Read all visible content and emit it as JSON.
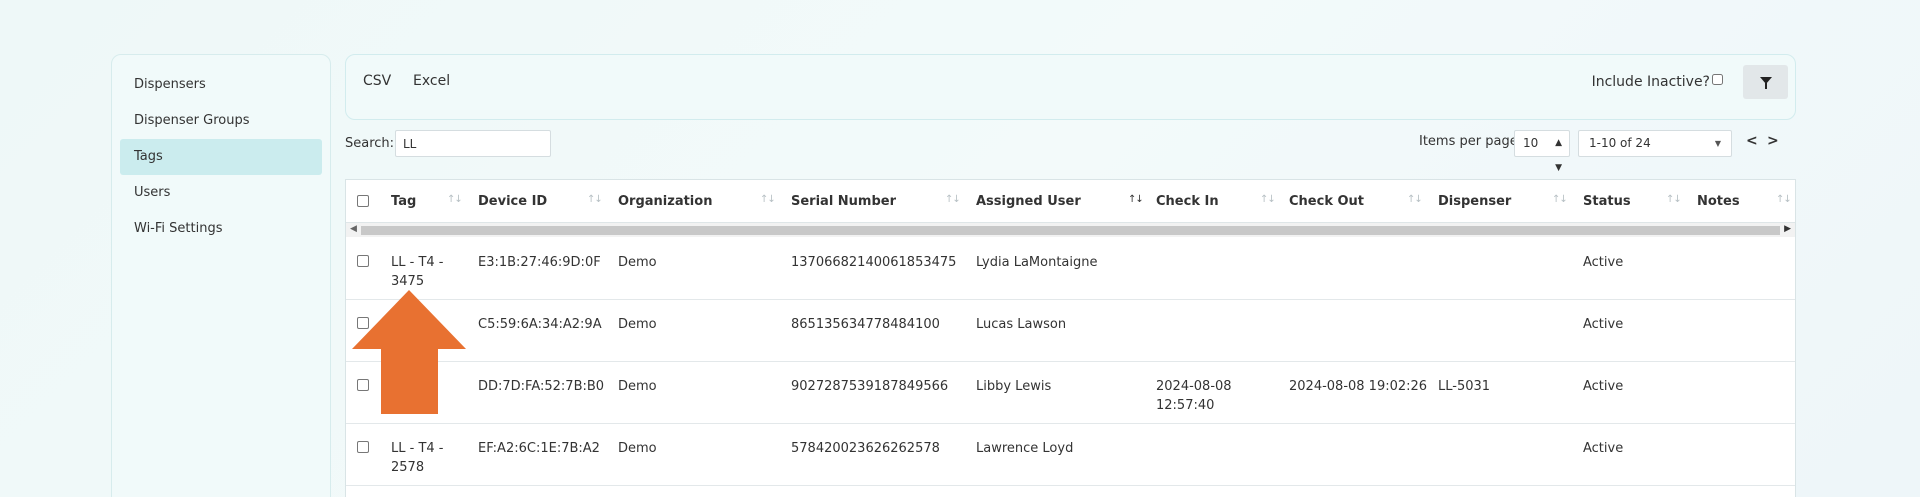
{
  "sidebar": {
    "items": [
      {
        "label": "Dispensers",
        "active": false
      },
      {
        "label": "Dispenser Groups",
        "active": false
      },
      {
        "label": "Tags",
        "active": true
      },
      {
        "label": "Users",
        "active": false
      },
      {
        "label": "Wi-Fi Settings",
        "active": false
      }
    ]
  },
  "toolbar": {
    "csv_label": "CSV",
    "excel_label": "Excel",
    "include_inactive_label": "Include Inactive?",
    "include_inactive_checked": false,
    "filter_icon": "filter-icon"
  },
  "search": {
    "label": "Search:",
    "value": "LL"
  },
  "pagination": {
    "items_per_page_label": "Items per page:",
    "items_per_page_value": "10",
    "range_value": "1-10 of 24",
    "prev_label": "<",
    "next_label": ">"
  },
  "table": {
    "columns": [
      "Tag",
      "Device ID",
      "Organization",
      "Serial Number",
      "Assigned User",
      "Check In",
      "Check Out",
      "Dispenser",
      "Status",
      "Notes"
    ],
    "rows": [
      {
        "tag_line1": "LL - T4 -",
        "tag_line2": "3475",
        "device_id": "E3:1B:27:46:9D:0F",
        "organization": "Demo",
        "serial": "13706682140061853475",
        "user": "Lydia LaMontaigne",
        "check_in_line1": "",
        "check_in_line2": "",
        "check_out": "",
        "dispenser": "",
        "status": "Active",
        "notes": ""
      },
      {
        "tag_line1": "",
        "tag_line2": "",
        "device_id": "C5:59:6A:34:A2:9A",
        "organization": "Demo",
        "serial": "865135634778484100",
        "user": "Lucas Lawson",
        "check_in_line1": "",
        "check_in_line2": "",
        "check_out": "",
        "dispenser": "",
        "status": "Active",
        "notes": ""
      },
      {
        "tag_line1": "",
        "tag_line2": "",
        "device_id": "DD:7D:FA:52:7B:B0",
        "organization": "Demo",
        "serial": "9027287539187849566",
        "user": "Libby Lewis",
        "check_in_line1": "2024-08-08",
        "check_in_line2": "12:57:40",
        "check_out": "2024-08-08 19:02:26",
        "dispenser": "LL-5031",
        "status": "Active",
        "notes": ""
      },
      {
        "tag_line1": "LL - T4 -",
        "tag_line2": "2578",
        "device_id": "EF:A2:6C:1E:7B:A2",
        "organization": "Demo",
        "serial": "578420023626262578",
        "user": "Lawrence Loyd",
        "check_in_line1": "",
        "check_in_line2": "",
        "check_out": "",
        "dispenser": "",
        "status": "Active",
        "notes": ""
      }
    ]
  },
  "colors": {
    "accent_link": "#2f6fc4",
    "sidebar_active": "#cbecee",
    "annotation_arrow": "#e87131"
  }
}
